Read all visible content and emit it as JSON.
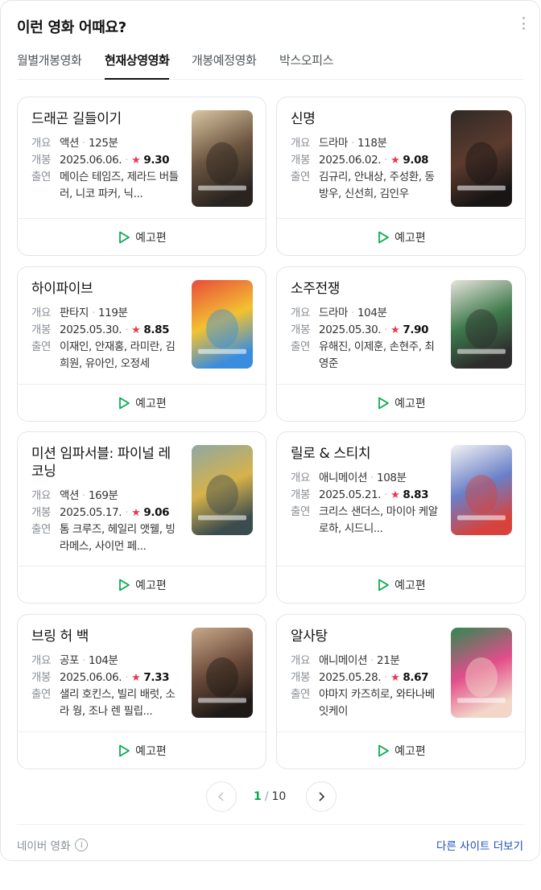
{
  "header": {
    "title": "이런 영화 어때요?",
    "more_icon": "more-vertical-icon"
  },
  "tabs": [
    {
      "label": "월별개봉영화"
    },
    {
      "label": "현재상영영화",
      "active": true
    },
    {
      "label": "개봉예정영화"
    },
    {
      "label": "박스오피스"
    }
  ],
  "labels": {
    "genre": "개요",
    "release": "개봉",
    "cast": "출연",
    "trailer": "예고편"
  },
  "movies": [
    {
      "title": "드래곤 길들이기",
      "genre": "액션",
      "runtime": "125분",
      "date": "2025.06.06.",
      "rating": "9.30",
      "cast": "메이슨 테임즈, 제라드 버틀러, 니코 파커, 닉...",
      "poster_colors": [
        "#d9c6a2",
        "#6b5540",
        "#2a2420"
      ]
    },
    {
      "title": "신명",
      "genre": "드라마",
      "runtime": "118분",
      "date": "2025.06.02.",
      "rating": "9.08",
      "cast": "김규리, 안내상, 주성환, 동방우, 신선희, 김인우",
      "poster_colors": [
        "#2f2a26",
        "#5c3b2e",
        "#181514"
      ]
    },
    {
      "title": "하이파이브",
      "genre": "판타지",
      "runtime": "119분",
      "date": "2025.05.30.",
      "rating": "8.85",
      "cast": "이재인, 안재홍, 라미란, 김희원, 유아인, 오정세",
      "poster_colors": [
        "#e94b3c",
        "#f2c230",
        "#3a8dde"
      ]
    },
    {
      "title": "소주전쟁",
      "genre": "드라마",
      "runtime": "104분",
      "date": "2025.05.30.",
      "rating": "7.90",
      "cast": "유해진, 이제훈, 손현주, 최영준",
      "poster_colors": [
        "#e8e4dc",
        "#3f7a4c",
        "#2d2d2d"
      ]
    },
    {
      "title": "미션 임파서블: 파이널 레코닝",
      "genre": "액션",
      "runtime": "169분",
      "date": "2025.05.17.",
      "rating": "9.06",
      "cast": "톰 크루즈, 헤일리 앳웰, 빙 라메스, 사이먼 페...",
      "poster_colors": [
        "#8fa8a3",
        "#d6b24a",
        "#3c4c4e"
      ]
    },
    {
      "title": "릴로 & 스티치",
      "genre": "애니메이션",
      "runtime": "108분",
      "date": "2025.05.21.",
      "rating": "8.83",
      "cast": "크리스 샌더스, 마이아 케알로하, 시드니...",
      "poster_colors": [
        "#f3f3f3",
        "#6a7fc7",
        "#d8423c"
      ]
    },
    {
      "title": "브링 허 백",
      "genre": "공포",
      "runtime": "104분",
      "date": "2025.06.06.",
      "rating": "7.33",
      "cast": "샐리 호킨스, 빌리 배럿, 소라 웡, 조나 렌 필립...",
      "poster_colors": [
        "#c9a98b",
        "#6b4b3a",
        "#1f1a17"
      ]
    },
    {
      "title": "알사탕",
      "genre": "애니메이션",
      "runtime": "21분",
      "date": "2025.05.28.",
      "rating": "8.67",
      "cast": "야마지 카즈히로, 와타나베 잇케이",
      "poster_colors": [
        "#2f8a52",
        "#e24d8a",
        "#f2d6c8"
      ]
    }
  ],
  "pager": {
    "current": "1",
    "sep": "/",
    "total": "10",
    "prev_icon": "chevron-left-icon",
    "next_icon": "chevron-right-icon"
  },
  "footer": {
    "source": "네이버 영화",
    "more": "다른 사이트 더보기"
  },
  "colors": {
    "accent_green": "#03a94d",
    "star_red": "#e8384f",
    "link_blue": "#1f4db8"
  }
}
